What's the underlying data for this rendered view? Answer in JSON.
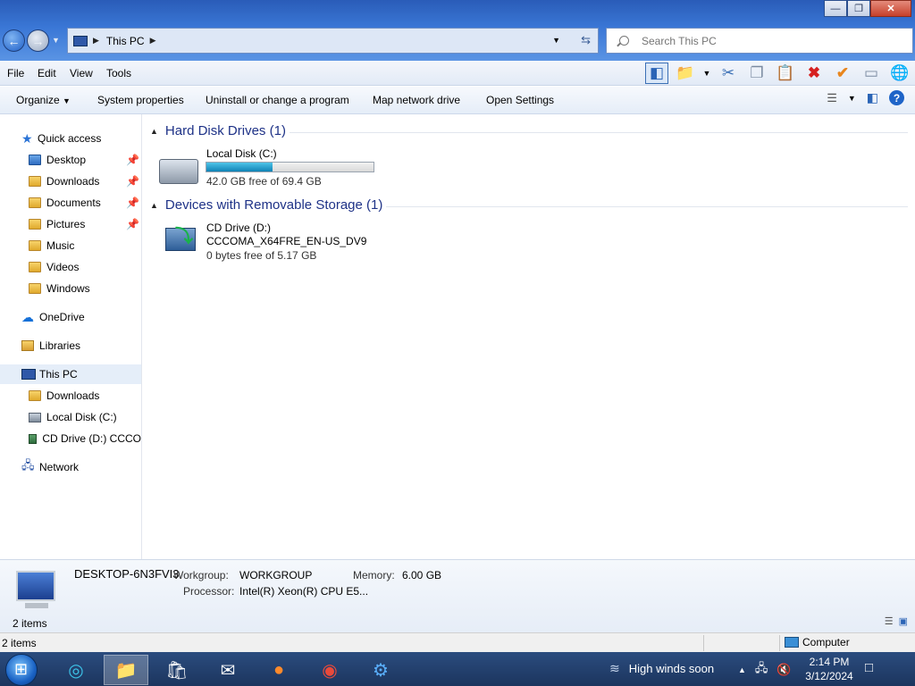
{
  "window": {
    "minimize_icon": "minimize-icon",
    "maximize_icon": "restore-icon",
    "close_icon": "close-icon"
  },
  "address": {
    "back_icon": "back-arrow-icon",
    "forward_icon": "forward-arrow-icon",
    "path_segment": "This PC",
    "refresh_icon": "refresh-icon"
  },
  "search": {
    "placeholder": "Search This PC",
    "value": ""
  },
  "menu": {
    "file": "File",
    "edit": "Edit",
    "view": "View",
    "tools": "Tools"
  },
  "toolbar_icons": [
    "preview-pane-icon",
    "folder-properties-icon",
    "cut-icon",
    "copy-icon",
    "paste-icon",
    "delete-icon",
    "check-icon",
    "rename-icon",
    "globe-icon"
  ],
  "commands": {
    "organize": "Organize",
    "system_properties": "System properties",
    "uninstall": "Uninstall or change a program",
    "map_drive": "Map network drive",
    "open_settings": "Open Settings"
  },
  "nav": {
    "quick_access": "Quick access",
    "desktop": "Desktop",
    "downloads": "Downloads",
    "documents": "Documents",
    "pictures": "Pictures",
    "music": "Music",
    "videos": "Videos",
    "windows": "Windows",
    "onedrive": "OneDrive",
    "libraries": "Libraries",
    "this_pc": "This PC",
    "pc_downloads": "Downloads",
    "local_disk": "Local Disk (C:)",
    "cd_drive": "CD Drive (D:) CCCO",
    "network": "Network"
  },
  "groups": {
    "hard_disks": "Hard Disk Drives (1)",
    "removable": "Devices with Removable Storage (1)"
  },
  "drives": {
    "c_name": "Local Disk (C:)",
    "c_free": "42.0 GB free of 69.4 GB",
    "c_used_fraction": 0.395,
    "d_name": "CD Drive (D:)",
    "d_label": "CCCOMA_X64FRE_EN-US_DV9",
    "d_free": "0 bytes free of 5.17 GB"
  },
  "details": {
    "computer_name": "DESKTOP-6N3FVI3",
    "workgroup_label": "Workgroup:",
    "workgroup_value": "WORKGROUP",
    "memory_label": "Memory:",
    "memory_value": "6.00 GB",
    "processor_label": "Processor:",
    "processor_value": "Intel(R) Xeon(R) CPU E5...",
    "items_count": "2 items"
  },
  "status": {
    "items": "2 items",
    "location": "Computer"
  },
  "taskbar": {
    "apps": [
      "edge-icon",
      "file-explorer-icon",
      "store-icon",
      "mail-icon",
      "firefox-icon",
      "chrome-icon",
      "settings-icon"
    ],
    "weather": "High winds soon",
    "time": "2:14 PM",
    "date": "3/12/2024"
  }
}
